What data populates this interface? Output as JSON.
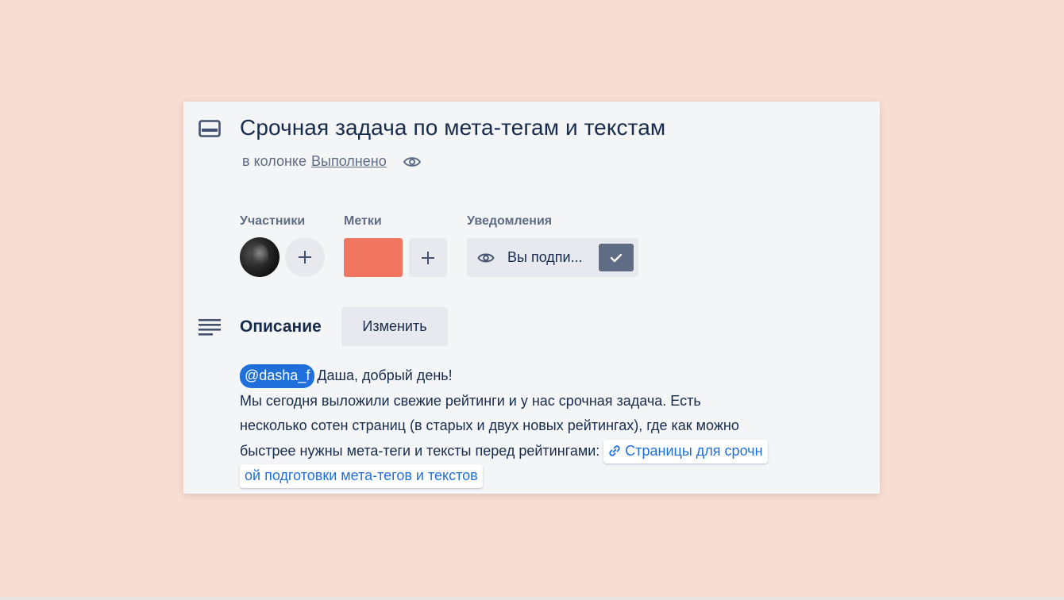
{
  "card": {
    "title": "Срочная задача по мета-тегам и текстам",
    "subtitle_prefix": "в колонке",
    "column_name": "Выполнено",
    "icons": {
      "header": "card-icon",
      "watch": "eye-icon",
      "description": "description-lines-icon"
    }
  },
  "members": {
    "label": "Участники",
    "add_icon": "plus-icon"
  },
  "labels": {
    "label": "Метки",
    "chip_color": "#f07662",
    "add_icon": "plus-icon"
  },
  "notifications": {
    "label": "Уведомления",
    "button_text": "Вы подпи...",
    "icon": "eye-icon",
    "check_icon": "checkmark-icon"
  },
  "description": {
    "title": "Описание",
    "edit_label": "Изменить",
    "mention": "@dasha_f",
    "greeting": "Даша, добрый день!",
    "line1": "Мы сегодня выложили свежие рейтинги и у нас срочная задача. Есть",
    "line2": "несколько сотен страниц (в старых и двух новых рейтингах), где как можно",
    "line3": "быстрее нужны мета-теги и тексты перед рейтингами:",
    "link_part1": "Страницы для срочн",
    "link_part2": "ой подготовки мета-тегов и текстов",
    "link_icon": "link-icon"
  },
  "colors": {
    "background": "#f8ddd2",
    "card": "#f4f5f7",
    "accent": "#1f6fdb",
    "label_red": "#f07662",
    "check_box": "#5e6c84"
  }
}
